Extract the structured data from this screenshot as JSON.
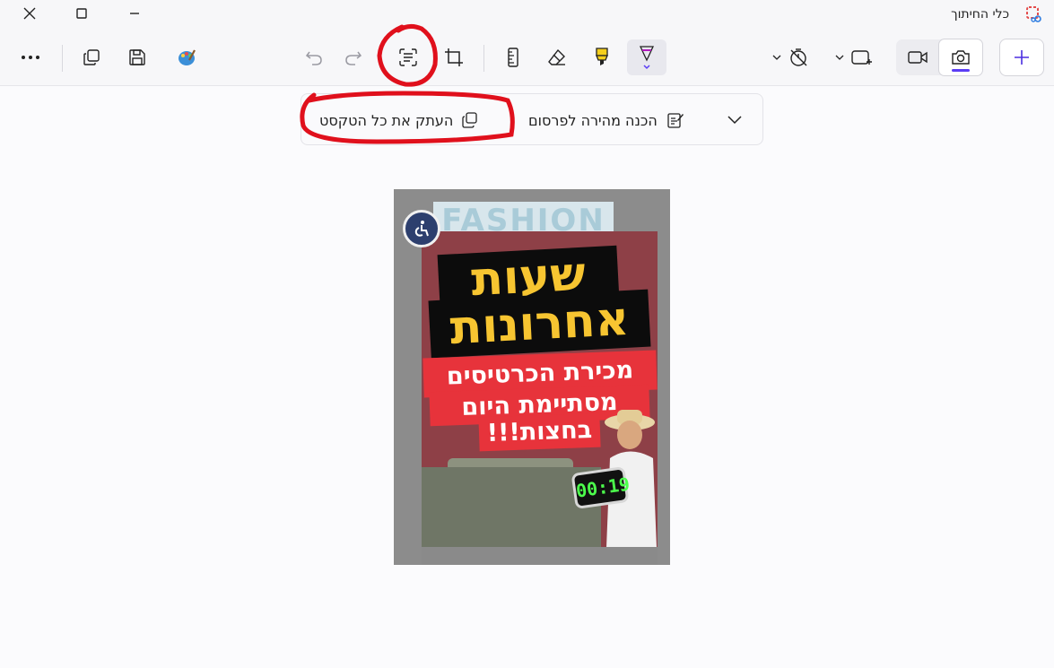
{
  "window": {
    "title": "כלי החיתוך"
  },
  "toolbar": {
    "more": "more-options",
    "copy": "copy",
    "save": "save",
    "edit_paint": "edit-in-paint",
    "undo": "undo",
    "redo": "redo",
    "text_actions": "text-actions",
    "crop": "crop",
    "ruler": "ruler",
    "eraser": "eraser",
    "highlighter": "highlighter",
    "pen": "pen",
    "delay": "timer",
    "snip_shape": "rectangle-mode",
    "video_mode": "video",
    "photo_mode": "camera",
    "new": "new-snip"
  },
  "text_actions_bar": {
    "copy_all_text": "העתק את כל הטקסט",
    "quick_redact": "הכנה מהירה לפרסום"
  },
  "poster": {
    "banner": "FASHION",
    "headline_line1": "שעות",
    "headline_line2": "אחרונות",
    "sub_line1": "מכירת הכרטיסים",
    "sub_line2": "מסתיימת היום",
    "sub_line3": "בחצות!!!",
    "clock": "00:19"
  },
  "colors": {
    "accent": "#5b3df5",
    "poster_red": "#e7333b",
    "headline_yellow": "#f7c531",
    "annotation_red": "#e0101c"
  }
}
